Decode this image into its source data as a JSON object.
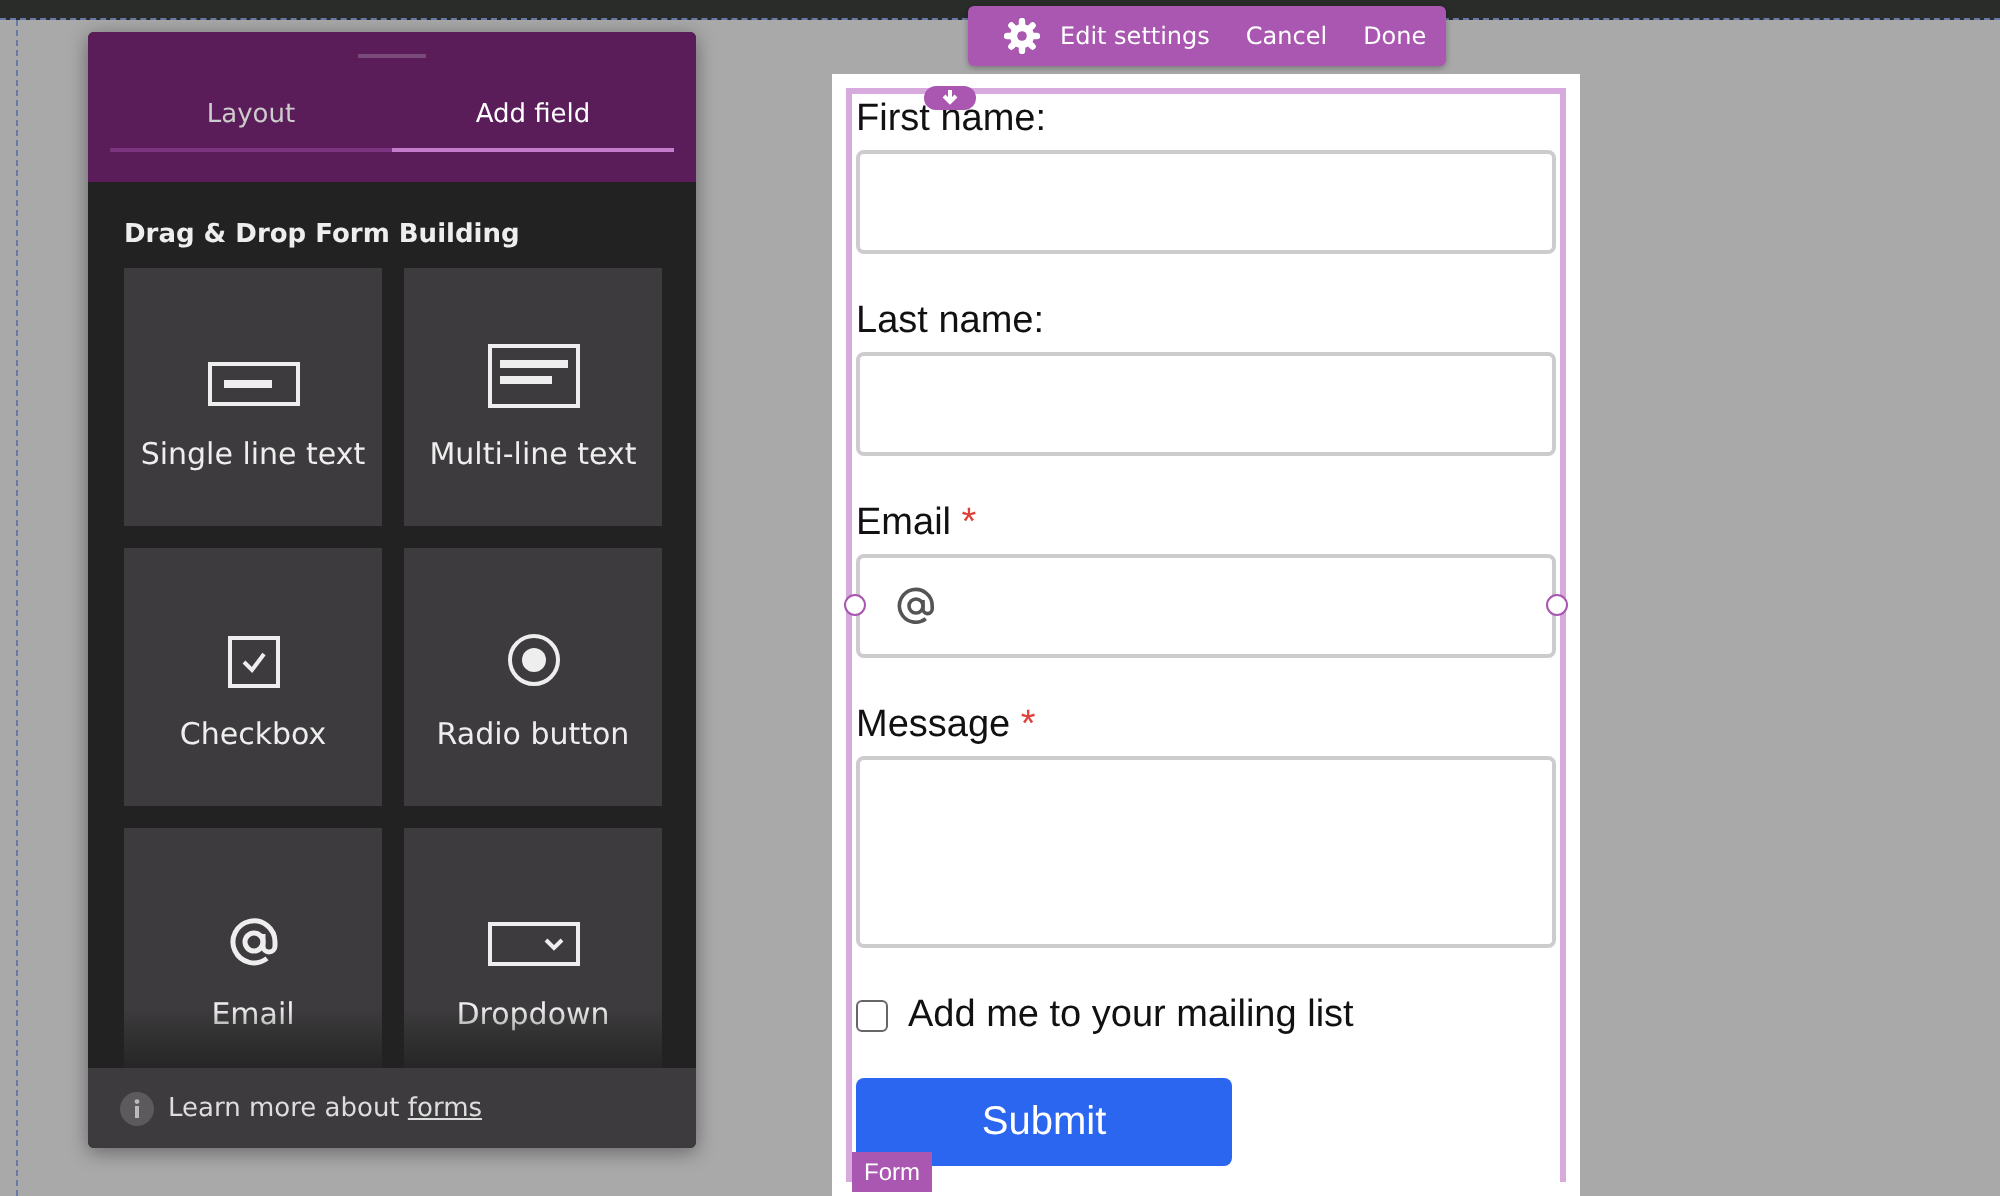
{
  "toolbar": {
    "buttons": [
      {
        "label": "Edit settings",
        "kind": "settings"
      },
      {
        "label": "Cancel",
        "kind": "plain"
      },
      {
        "label": "Done",
        "kind": "plain"
      }
    ]
  },
  "panel": {
    "tabs": [
      {
        "label": "Layout",
        "selected": false
      },
      {
        "label": "Add field",
        "selected": true
      }
    ],
    "heading": "Drag & Drop Form Building",
    "tiles": [
      {
        "label": "Single line text",
        "kind": "single"
      },
      {
        "label": "Multi-line text",
        "kind": "multi"
      },
      {
        "label": "Checkbox",
        "kind": "checkbox"
      },
      {
        "label": "Radio button",
        "kind": "radio"
      },
      {
        "label": "Email",
        "kind": "email"
      },
      {
        "label": "Dropdown",
        "kind": "dropdown"
      }
    ],
    "footer": {
      "text": "Learn more about",
      "link": "forms"
    }
  },
  "form": {
    "fields": [
      {
        "label": "First name:",
        "kind": "text",
        "required": false
      },
      {
        "label": "Last name:",
        "kind": "text",
        "required": false
      },
      {
        "label": "Email",
        "kind": "email",
        "required": true,
        "selected": true
      },
      {
        "label": "Message",
        "kind": "textarea",
        "required": true
      }
    ],
    "required_mark": "*",
    "checkbox": {
      "label": "Add me to your mailing list",
      "checked": false
    },
    "submit": "Submit",
    "tag": "Form"
  }
}
